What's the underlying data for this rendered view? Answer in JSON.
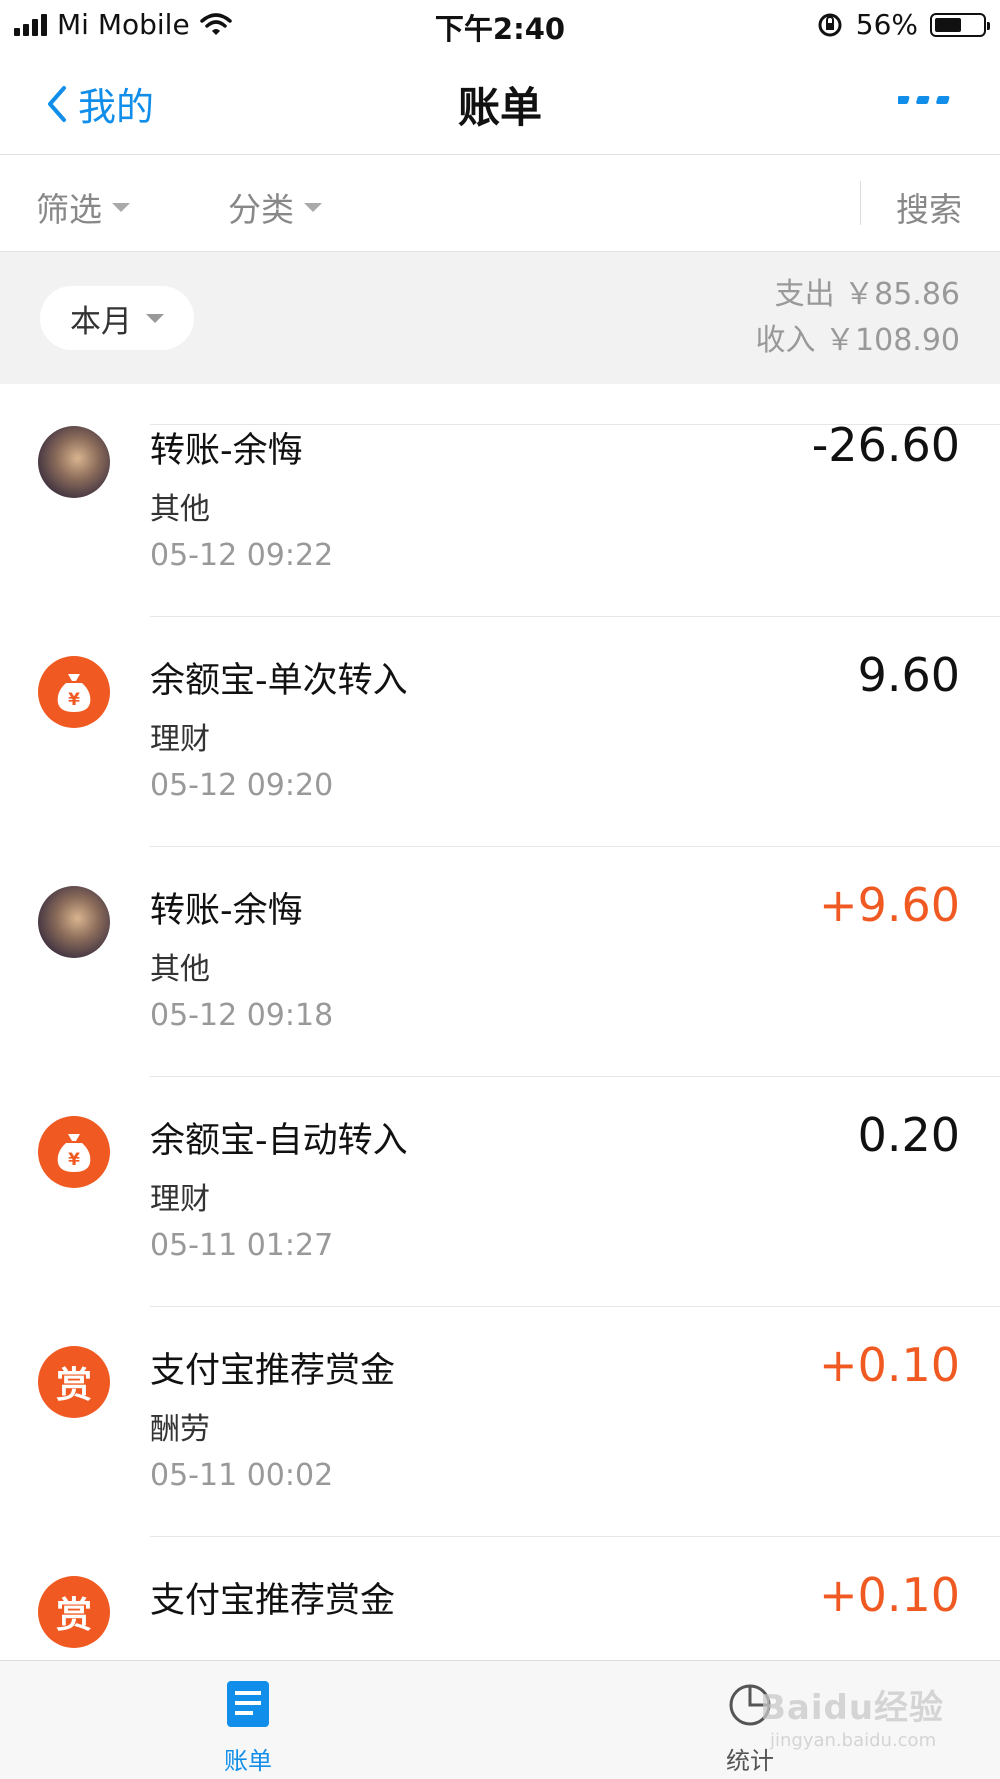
{
  "status_bar": {
    "carrier": "Mi Mobile",
    "time": "下午2:40",
    "battery_percent": "56%",
    "battery_level": 0.56,
    "icons": [
      "signal-icon",
      "wifi-icon",
      "orientation-lock-icon",
      "battery-icon"
    ]
  },
  "nav": {
    "back_label": "我的",
    "title": "账单",
    "icons": [
      "chevron-left-icon",
      "more-icon"
    ]
  },
  "filters": {
    "filter_label": "筛选",
    "category_label": "分类",
    "search_label": "搜索"
  },
  "month": {
    "selector_label": "本月",
    "expense": "支出 ￥85.86",
    "income": "收入 ￥108.90"
  },
  "transactions": [
    {
      "title": "转账-余悔",
      "category": "其他",
      "time": "05-12  09:22",
      "amount": "-26.60",
      "type": "expense",
      "icon": "avatar-photo"
    },
    {
      "title": "余额宝-单次转入",
      "category": "理财",
      "time": "05-12  09:20",
      "amount": "9.60",
      "type": "neutral",
      "icon": "money-bag-icon"
    },
    {
      "title": "转账-余悔",
      "category": "其他",
      "time": "05-12  09:18",
      "amount": "+9.60",
      "type": "income",
      "icon": "avatar-photo"
    },
    {
      "title": "余额宝-自动转入",
      "category": "理财",
      "time": "05-11  01:27",
      "amount": "0.20",
      "type": "neutral",
      "icon": "money-bag-icon"
    },
    {
      "title": "支付宝推荐赏金",
      "category": "酬劳",
      "time": "05-11  00:02",
      "amount": "+0.10",
      "type": "income",
      "icon": "reward-icon",
      "icon_text": "赏"
    },
    {
      "title": "支付宝推荐赏金",
      "category": "",
      "time": "",
      "amount": "+0.10",
      "type": "income",
      "icon": "reward-icon",
      "icon_text": "赏"
    }
  ],
  "tabs": [
    {
      "label": "账单",
      "active": true,
      "icon": "bill-list-icon"
    },
    {
      "label": "统计",
      "active": false,
      "icon": "pie-chart-icon"
    }
  ],
  "watermark": {
    "text": "Baidu经验",
    "sub": "jingyan.baidu.com"
  },
  "colors": {
    "accent": "#108ee9",
    "income": "#f05a22",
    "muted": "#999999",
    "header_bg": "#f2f2f2"
  }
}
